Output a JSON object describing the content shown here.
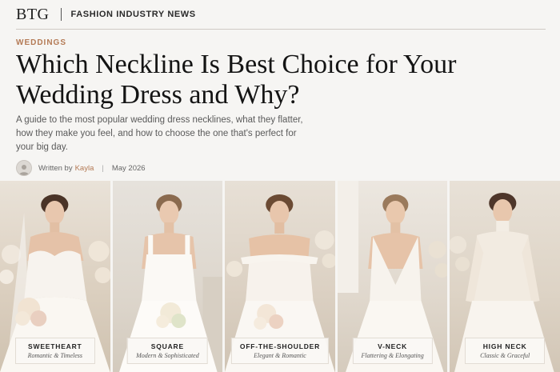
{
  "header": {
    "logo": "BTG",
    "section_title": "FASHION INDUSTRY NEWS"
  },
  "article": {
    "category": "WEDDINGS",
    "title": "Which Neckline Is Best Choice for Your Wedding Dress and Why?",
    "dek": "A guide to the most popular wedding dress necklines, what they flatter, how they make you feel, and how to choose the one that's perfect for your big day.",
    "byline_prefix": "Written by",
    "author": "Kayla",
    "separator": "|",
    "date": "May 2026"
  },
  "gallery": [
    {
      "name": "SWEETHEART",
      "subtitle": "Romantic & Timeless"
    },
    {
      "name": "SQUARE",
      "subtitle": "Modern & Sophisticated"
    },
    {
      "name": "OFF-THE-SHOULDER",
      "subtitle": "Elegant & Romantic"
    },
    {
      "name": "V-NECK",
      "subtitle": "Flattering & Elongating"
    },
    {
      "name": "HIGH NECK",
      "subtitle": "Classic & Graceful"
    }
  ],
  "colors": {
    "accent": "#b47a55",
    "background": "#f6f5f3",
    "headline": "#141414"
  },
  "icons": {
    "author_avatar": "user-avatar-icon"
  }
}
